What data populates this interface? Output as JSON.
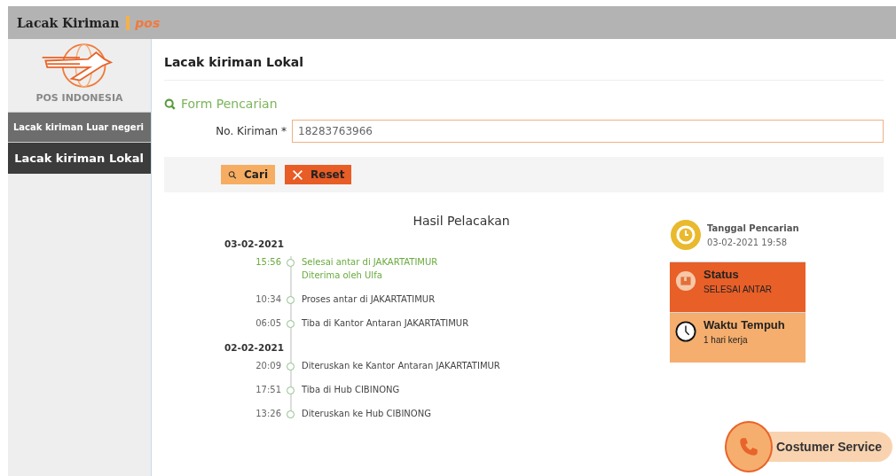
{
  "header": {
    "title": "Lacak Kiriman",
    "logo_text": "pos"
  },
  "sidebar": {
    "brand": "POS INDONESIA",
    "items": [
      {
        "label": "Lacak kiriman Luar negeri",
        "selected": false
      },
      {
        "label": "Lacak kiriman Lokal",
        "selected": true
      }
    ]
  },
  "page_title": "Lacak kiriman Lokal",
  "form": {
    "title": "Form Pencarian",
    "field_label": "No. Kiriman *",
    "value": "18283763966",
    "buttons": [
      {
        "label": "Cari",
        "kind": "search"
      },
      {
        "label": "Reset",
        "kind": "reset"
      }
    ]
  },
  "results": {
    "title": "Hasil Pelacakan",
    "days": [
      {
        "date": "03-02-2021",
        "events": [
          {
            "time": "15:56",
            "lines": [
              "Selesai antar di JAKARTATIMUR",
              "Diterima oleh Ulfa"
            ],
            "highlighted": true
          },
          {
            "time": "10:34",
            "lines": [
              "Proses antar di JAKARTATIMUR"
            ],
            "highlighted": false
          },
          {
            "time": "06:05",
            "lines": [
              "Tiba di Kantor Antaran JAKARTATIMUR"
            ],
            "highlighted": false
          }
        ]
      },
      {
        "date": "02-02-2021",
        "events": [
          {
            "time": "20:09",
            "lines": [
              "Diteruskan ke Kantor Antaran JAKARTATIMUR"
            ],
            "highlighted": false
          },
          {
            "time": "17:51",
            "lines": [
              "Tiba di Hub CIBINONG"
            ],
            "highlighted": false
          },
          {
            "time": "13:26",
            "lines": [
              "Diteruskan ke Hub CIBINONG"
            ],
            "highlighted": false
          }
        ]
      }
    ]
  },
  "info": {
    "search_date_label": "Tanggal Pencarian",
    "search_date": "03-02-2021 19:58",
    "cards": [
      {
        "kind": "status",
        "title": "Status",
        "value": "SELESAI ANTAR"
      },
      {
        "kind": "duration",
        "title": "Waktu Tempuh",
        "value": "1 hari kerja"
      }
    ]
  },
  "customer_service": "Costumer Service"
}
